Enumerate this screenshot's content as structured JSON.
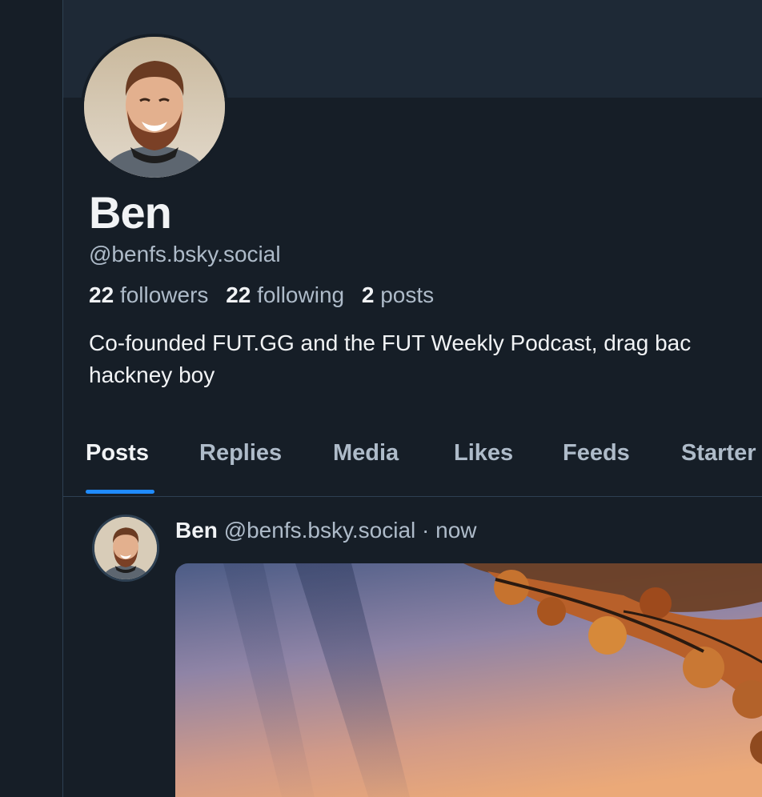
{
  "profile": {
    "display_name": "Ben",
    "handle": "@benfs.bsky.social",
    "followers_count": "22",
    "followers_label": "followers",
    "following_count": "22",
    "following_label": "following",
    "posts_count": "2",
    "posts_label": "posts",
    "bio": "Co-founded FUT.GG and the FUT Weekly Podcast, drag bac\nhackney boy"
  },
  "tabs": [
    {
      "label": "Posts",
      "active": true
    },
    {
      "label": "Replies",
      "active": false
    },
    {
      "label": "Media",
      "active": false
    },
    {
      "label": "Likes",
      "active": false
    },
    {
      "label": "Feeds",
      "active": false
    },
    {
      "label": "Starter",
      "active": false
    }
  ],
  "post": {
    "author_name": "Ben",
    "author_handle": "@benfs.bsky.social",
    "separator": "·",
    "timestamp": "now",
    "image_icon": "sunset-photo"
  },
  "colors": {
    "background": "#161e27",
    "banner": "#1e2936",
    "text_primary": "#f1f3f5",
    "text_secondary": "#aebbc9",
    "accent": "#208bfe",
    "border": "#2e4052"
  }
}
